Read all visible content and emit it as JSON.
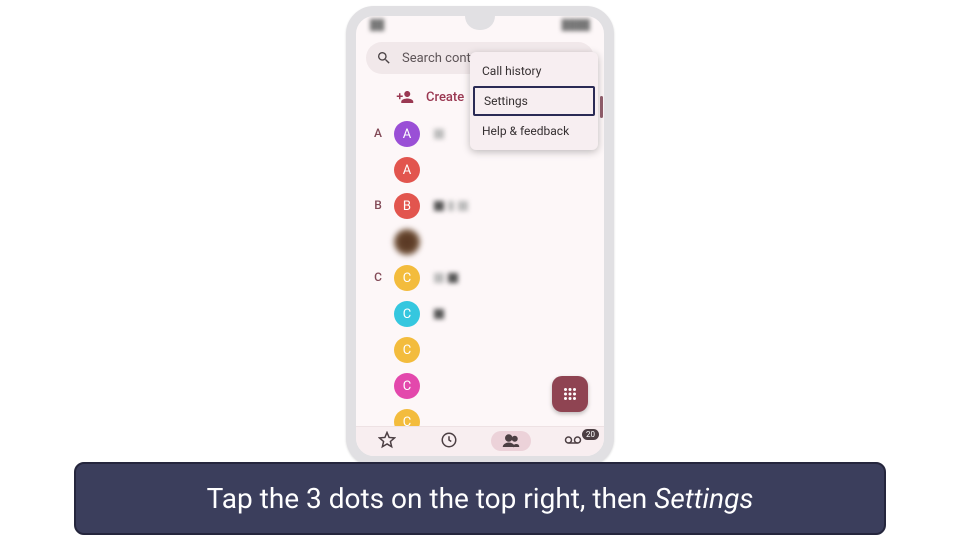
{
  "search": {
    "placeholder": "Search contacts"
  },
  "create": {
    "label": "Create"
  },
  "menu": {
    "items": [
      {
        "label": "Call history"
      },
      {
        "label": "Settings",
        "highlight": true
      },
      {
        "label": "Help & feedback"
      }
    ]
  },
  "sections": [
    {
      "letter": "A",
      "contacts": [
        {
          "initial": "A",
          "color": "#9a4fd6"
        },
        {
          "initial": "A",
          "color": "#e2554e"
        }
      ]
    },
    {
      "letter": "B",
      "contacts": [
        {
          "initial": "B",
          "color": "#e2554e"
        },
        {
          "blur": true
        }
      ]
    },
    {
      "letter": "C",
      "contacts": [
        {
          "initial": "C",
          "color": "#f3bc3d"
        },
        {
          "initial": "C",
          "color": "#35c7df"
        },
        {
          "initial": "C",
          "color": "#f3bc3d"
        },
        {
          "initial": "C",
          "color": "#e348ac"
        },
        {
          "initial": "C",
          "color": "#f3bc3d"
        }
      ]
    }
  ],
  "bottom_nav": {
    "voicemail_badge": "20"
  },
  "caption": {
    "pre": "Tap the 3 dots on the top right, then ",
    "italic": "Settings"
  }
}
